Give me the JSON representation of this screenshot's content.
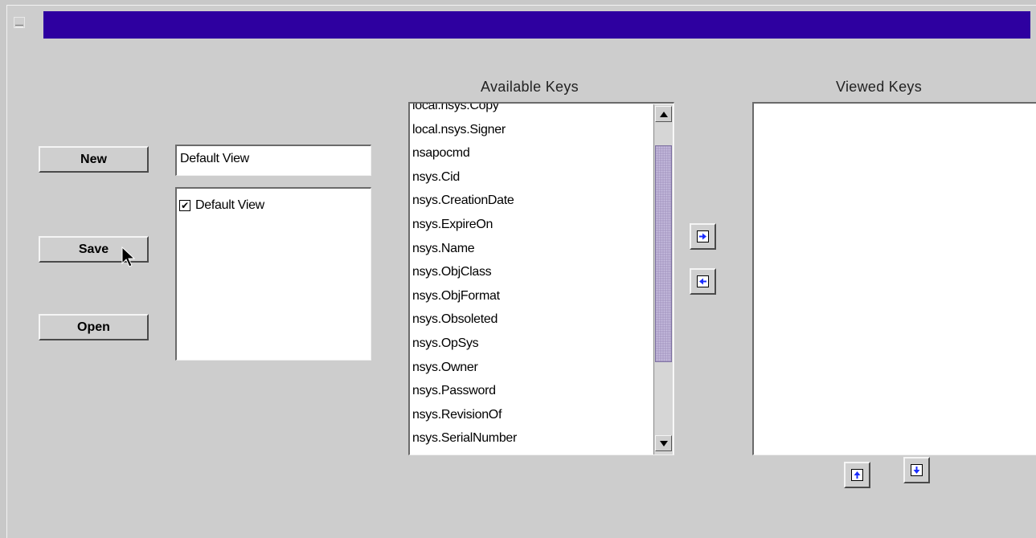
{
  "window": {
    "title": ""
  },
  "buttons": {
    "new_label": "New",
    "save_label": "Save",
    "open_label": "Open"
  },
  "view_name_input": {
    "value": "Default View"
  },
  "views_list": {
    "items": [
      {
        "label": "Default View",
        "checked": true
      }
    ]
  },
  "available_keys": {
    "heading": "Available Keys",
    "items": [
      "local.nsys.Copy",
      "local.nsys.Signer",
      "nsapocmd",
      "nsys.Cid",
      "nsys.CreationDate",
      "nsys.ExpireOn",
      "nsys.Name",
      "nsys.ObjClass",
      "nsys.ObjFormat",
      "nsys.Obsoleted",
      "nsys.OpSys",
      "nsys.Owner",
      "nsys.Password",
      "nsys.RevisionOf",
      "nsys.SerialNumber"
    ]
  },
  "viewed_keys": {
    "heading": "Viewed Keys",
    "items": []
  },
  "colors": {
    "titlebar": "#2e00a0",
    "background": "#cdcdcd",
    "scroll_thumb": "#a89bc4",
    "arrow_icon": "#1a2cff"
  },
  "icons": {
    "add": "arrow-right-icon",
    "remove": "arrow-left-icon",
    "move_up": "arrow-up-icon",
    "move_down": "arrow-down-icon"
  }
}
